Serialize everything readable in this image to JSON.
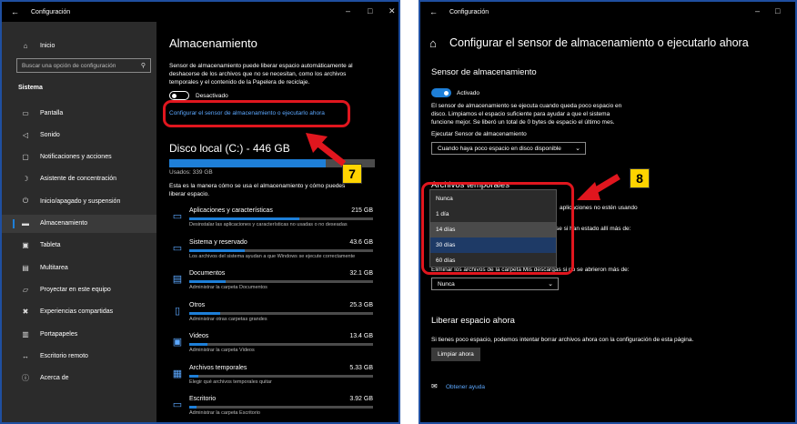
{
  "left": {
    "title": "Configuración",
    "sidebar": {
      "home": "Inicio",
      "search_placeholder": "Buscar una opción de configuración",
      "section": "Sistema",
      "items": [
        {
          "label": "Pantalla",
          "icon": "monitor-icon"
        },
        {
          "label": "Sonido",
          "icon": "speaker-icon"
        },
        {
          "label": "Notificaciones y acciones",
          "icon": "notification-icon"
        },
        {
          "label": "Asistente de concentración",
          "icon": "moon-icon"
        },
        {
          "label": "Inicio/apagado y suspensión",
          "icon": "power-icon"
        },
        {
          "label": "Almacenamiento",
          "icon": "storage-icon",
          "active": true
        },
        {
          "label": "Tableta",
          "icon": "tablet-icon"
        },
        {
          "label": "Multitarea",
          "icon": "multitask-icon"
        },
        {
          "label": "Proyectar en este equipo",
          "icon": "project-icon"
        },
        {
          "label": "Experiencias compartidas",
          "icon": "shared-icon"
        },
        {
          "label": "Portapapeles",
          "icon": "clipboard-icon"
        },
        {
          "label": "Escritorio remoto",
          "icon": "remote-icon"
        },
        {
          "label": "Acerca de",
          "icon": "info-icon"
        }
      ]
    },
    "main": {
      "heading": "Almacenamiento",
      "desc_lines": [
        "Sensor de almacenamiento puede liberar espacio automáticamente al",
        "deshacerse de los archivos que no se necesitan, como los archivos",
        "temporales y el contenido de la Papelera de reciclaje."
      ],
      "toggle_label": "Desactivado",
      "configure_link": "Configurar el sensor de almacenamiento o ejecutarlo ahora",
      "disk_title": "Disco local (C:) - 446 GB",
      "used_label": "Usados: 339 GB",
      "disk_used_fraction": 0.76,
      "usage_lines": [
        "Esta es la manera cómo se usa el almacenamiento y cómo puedes",
        "liberar espacio."
      ],
      "categories": [
        {
          "name": "Aplicaciones y características",
          "size": "215 GB",
          "desc": "Desinstalar las aplicaciones y características no usadas o no deseadas",
          "fraction": 0.6,
          "icon": "apps-icon"
        },
        {
          "name": "Sistema y reservado",
          "size": "43.6 GB",
          "desc": "Los archivos del sistema ayudan a que Windows se ejecute correctamente",
          "fraction": 0.3,
          "icon": "system-icon"
        },
        {
          "name": "Documentos",
          "size": "32.1 GB",
          "desc": "Administrar la carpeta Documentos",
          "fraction": 0.2,
          "icon": "documents-icon"
        },
        {
          "name": "Otros",
          "size": "25.3 GB",
          "desc": "Administrar otras carpetas grandes",
          "fraction": 0.17,
          "icon": "other-icon"
        },
        {
          "name": "Videos",
          "size": "13.4 GB",
          "desc": "Administrar la carpeta Videos",
          "fraction": 0.1,
          "icon": "video-icon"
        },
        {
          "name": "Archivos temporales",
          "size": "5.33 GB",
          "desc": "Elegir qué archivos temporales quitar",
          "fraction": 0.05,
          "icon": "trash-icon"
        },
        {
          "name": "Escritorio",
          "size": "3.92 GB",
          "desc": "Administrar la carpeta Escritorio",
          "fraction": 0.04,
          "icon": "desktop-icon"
        }
      ]
    },
    "badge": "7"
  },
  "right": {
    "title": "Configuración",
    "heading": "Configurar el sensor de almacenamiento o ejecutarlo ahora",
    "sensor_heading": "Sensor de almacenamiento",
    "toggle_label": "Activado",
    "sensor_desc_lines": [
      "El sensor de almacenamiento se ejecuta cuando queda poco espacio en",
      "disco. Limpiamos el espacio suficiente para ayudar a que el sistema",
      "funcione mejor. Se liberó un total de 0 bytes de espacio el último mes."
    ],
    "run_label": "Ejecutar Sensor de almacenamiento",
    "run_value": "Cuando haya poco espacio en disco disponible",
    "temp_heading": "Archivos temporales",
    "partial_text_1": "aplicaciones no estén usando",
    "partial_text_2": "se si han estado allí más de:",
    "downloads_label": "Eliminar los archivos de la carpeta Mis descargas si no se abrieron más de:",
    "downloads_value": "Nunca",
    "dropdown_options": [
      "Nunca",
      "1 día",
      "14 días",
      "30 días",
      "60 días"
    ],
    "dropdown_selected": "30 días",
    "free_heading": "Liberar espacio ahora",
    "free_desc": "Si tienes poco espacio, podemos intentar borrar archivos ahora con la configuración de esta página.",
    "clean_button": "Limpiar ahora",
    "help_link": "Obtener ayuda",
    "badge": "8"
  },
  "colors": {
    "accent": "#1e7fd8",
    "highlight": "#e0161e",
    "badge": "#ffd400"
  }
}
